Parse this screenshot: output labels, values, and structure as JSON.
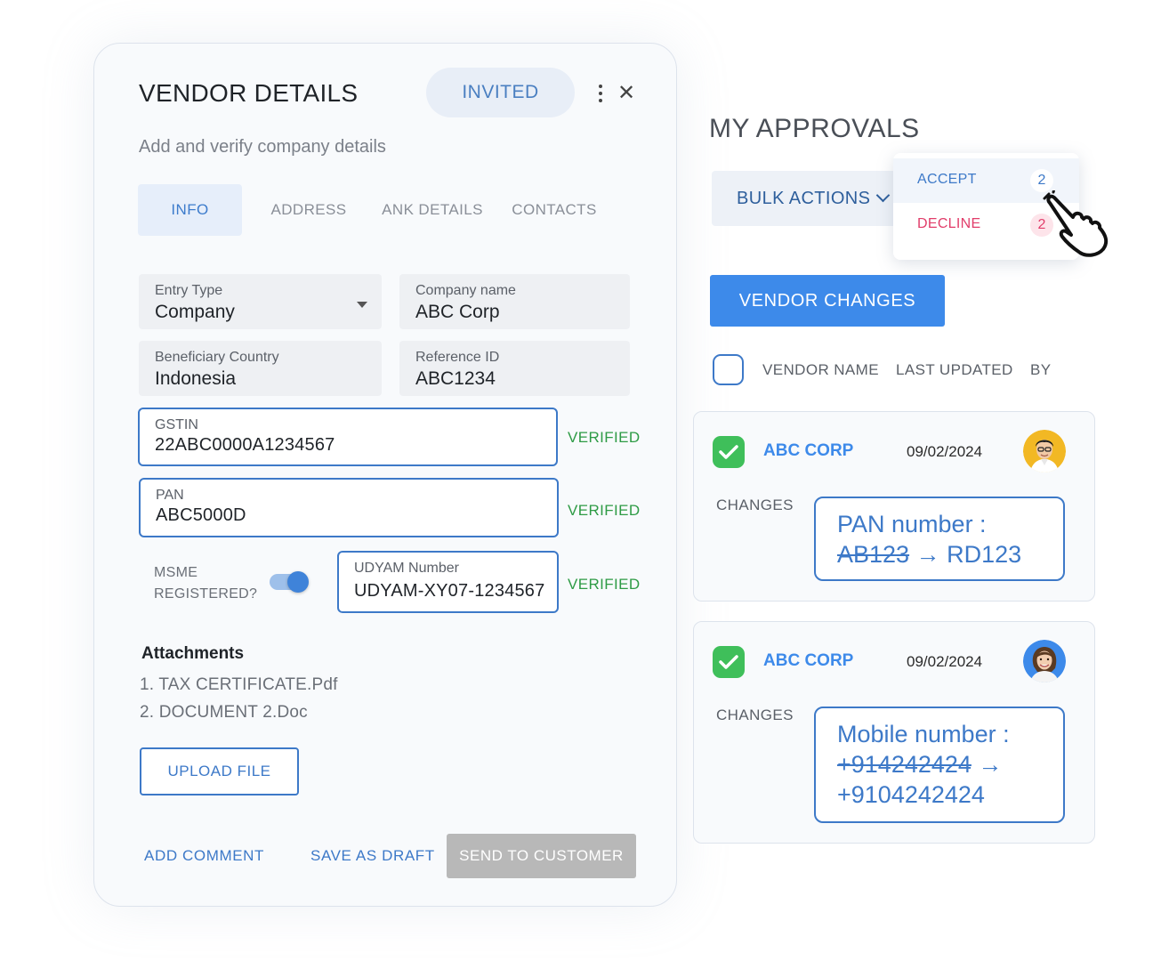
{
  "vendor_details": {
    "title": "VENDOR DETAILS",
    "status": "INVITED",
    "subtitle": "Add and verify company details",
    "tabs": [
      {
        "label": "INFO",
        "active": true
      },
      {
        "label": "ADDRESS",
        "active": false
      },
      {
        "label": "ANK DETAILS",
        "active": false
      },
      {
        "label": "CONTACTS",
        "active": false
      }
    ],
    "fields": {
      "entry_type": {
        "label": "Entry Type",
        "value": "Company"
      },
      "company_name": {
        "label": "Company name",
        "value": "ABC Corp"
      },
      "beneficiary_country": {
        "label": "Beneficiary Country",
        "value": "Indonesia"
      },
      "reference_id": {
        "label": "Reference ID",
        "value": "ABC1234"
      },
      "gstin": {
        "label": "GSTIN",
        "value": "22ABC0000A1234567",
        "status": "VERIFIED"
      },
      "pan": {
        "label": "PAN",
        "value": "ABC5000D",
        "status": "VERIFIED"
      },
      "udyam": {
        "label": "UDYAM Number",
        "value": "UDYAM-XY07-1234567",
        "status": "VERIFIED"
      }
    },
    "msme": {
      "label_line1": "MSME",
      "label_line2": "REGISTERED?",
      "enabled": true
    },
    "attachments": {
      "title": "Attachments",
      "items": [
        "1. TAX CERTIFICATE.Pdf",
        "2. DOCUMENT 2.Doc"
      ]
    },
    "upload_label": "UPLOAD FILE",
    "actions": {
      "add_comment": "ADD COMMENT",
      "save_draft": "SAVE AS DRAFT",
      "send": "SEND TO CUSTOMER"
    }
  },
  "approvals": {
    "title": "MY APPROVALS",
    "bulk_actions": "BULK ACTIONS",
    "dropdown": {
      "accept": {
        "label": "ACCEPT",
        "count": "2"
      },
      "decline": {
        "label": "DECLINE",
        "count": "2"
      }
    },
    "filter_button": "VENDOR CHANGES",
    "columns": [
      "VENDOR NAME",
      "LAST UPDATED",
      "BY"
    ],
    "items": [
      {
        "vendor": "ABC CORP",
        "date": "09/02/2024",
        "changes_label": "CHANGES",
        "field": "PAN number :",
        "old": "AB123",
        "arrow": "→",
        "new": "RD123"
      },
      {
        "vendor": "ABC CORP",
        "date": "09/02/2024",
        "changes_label": "CHANGES",
        "field": "Mobile number :",
        "old": "+914242424",
        "arrow": "→",
        "new": "+9104242424"
      }
    ]
  },
  "colors": {
    "accent": "#3d8aea",
    "link": "#3d79c8",
    "verified": "#2e9b45",
    "decline": "#e13d6a",
    "check": "#3fbf5a",
    "disabled": "#b8b8b8"
  },
  "icons": [
    "more-vertical-icon",
    "close-icon",
    "dropdown-caret-icon",
    "chevron-down-icon",
    "pointer-hand-icon",
    "checkmark-icon"
  ]
}
